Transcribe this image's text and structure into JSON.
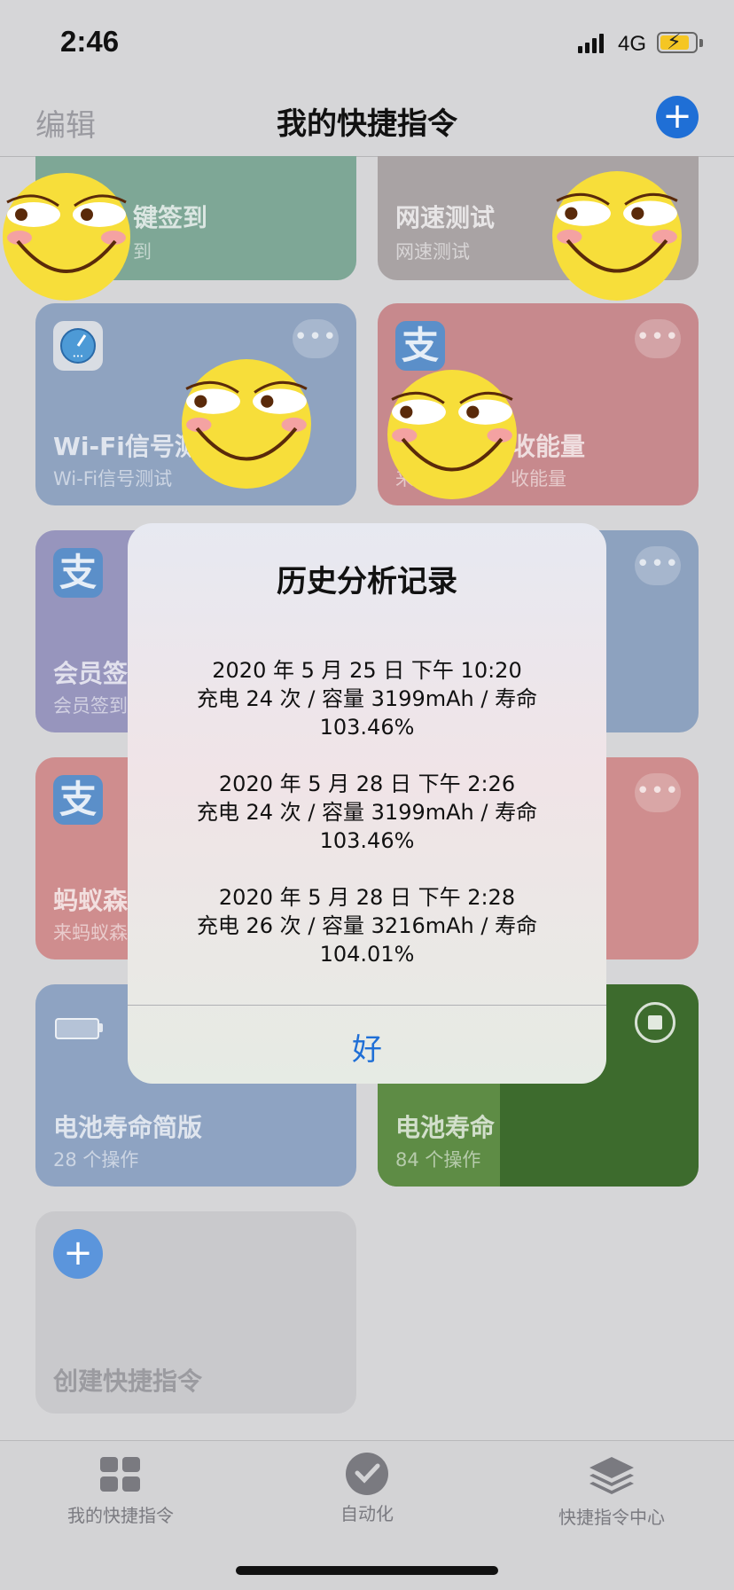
{
  "status": {
    "time": "2:46",
    "network": "4G"
  },
  "nav": {
    "edit": "编辑",
    "title": "我的快捷指令",
    "add": "+"
  },
  "cards": {
    "checkin": {
      "title": "键签到",
      "subtitle": "到"
    },
    "speedtest": {
      "title": "网速测试",
      "subtitle": "网速测试"
    },
    "wifi": {
      "title": "Wi-Fi信号测",
      "subtitle": "Wi-Fi信号测试",
      "more": "•••"
    },
    "energy": {
      "title": "收能量",
      "subtitle": "来",
      "subtitle2": "收能量",
      "icon": "支",
      "more": "•••"
    },
    "member": {
      "title": "会员签",
      "subtitle": "会员签到",
      "icon": "支",
      "more": "•••"
    },
    "ant": {
      "title": "蚂蚁森",
      "subtitle": "来蚂蚁森",
      "icon": "支",
      "more": "•••"
    },
    "battery_simple": {
      "title": "电池寿命简版",
      "subtitle": "28 个操作"
    },
    "battery_life": {
      "title": "电池寿命",
      "subtitle": "84 个操作"
    },
    "create": {
      "title": "创建快捷指令",
      "add": "+"
    }
  },
  "dialog": {
    "title": "历史分析记录",
    "entries": [
      {
        "date": "2020 年 5 月 25 日 下午 10:20",
        "line2": "充电 24 次 / 容量 3199mAh / 寿命",
        "line3": "103.46%"
      },
      {
        "date": "2020 年 5 月 28 日 下午 2:26",
        "line2": "充电 24 次 / 容量 3199mAh / 寿命",
        "line3": "103.46%"
      },
      {
        "date": "2020 年 5 月 28 日 下午 2:28",
        "line2": "充电 26 次 / 容量 3216mAh / 寿命",
        "line3": "104.01%"
      }
    ],
    "ok": "好"
  },
  "tabs": [
    {
      "label": "我的快捷指令",
      "icon": "grid-icon"
    },
    {
      "label": "自动化",
      "icon": "check-circle-icon"
    },
    {
      "label": "快捷指令中心",
      "icon": "layers-icon"
    }
  ],
  "colors": {
    "accent": "#1f6fd6",
    "card_green": "#7ea796",
    "card_blue": "#8da4c4",
    "card_pink": "#c99096",
    "card_red": "#cf8e8e",
    "card_darkgreen": "#3a6a2a"
  }
}
